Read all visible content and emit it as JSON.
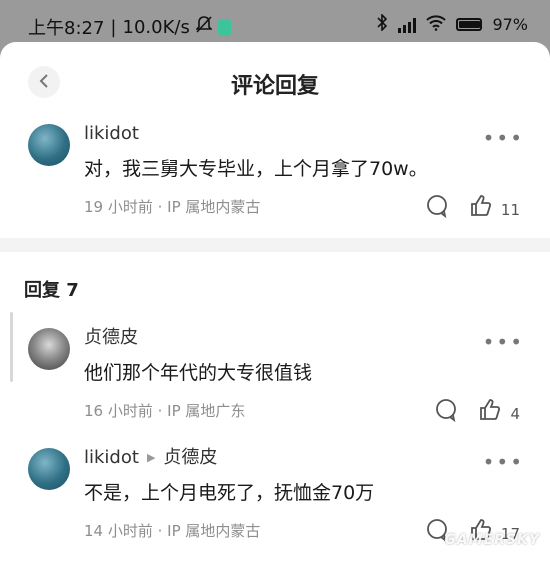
{
  "status_bar": {
    "time": "上午8:27",
    "net_speed": "10.0K/s",
    "battery": "97%",
    "icons": [
      "bell-off-icon",
      "app-notification-icon",
      "bluetooth-icon",
      "hd-signal-icon",
      "wifi-icon",
      "battery-icon"
    ]
  },
  "header": {
    "title": "评论回复",
    "back_icon": "chevron-left-icon"
  },
  "main_comment": {
    "author": "likidot",
    "text": "对，我三舅大专毕业，上个月拿了70w。",
    "meta": "19 小时前 · IP 属地内蒙古",
    "like_count": "11"
  },
  "replies_header": {
    "label": "回复 7"
  },
  "replies": [
    {
      "author": "贞德皮",
      "reply_to": "",
      "text": "他们那个年代的大专很值钱",
      "meta": "16 小时前 · IP 属地广东",
      "like_count": "4"
    },
    {
      "author": "likidot",
      "reply_to": "贞德皮",
      "text": "不是，上个月电死了，抚恤金70万",
      "meta": "14 小时前 · IP 属地内蒙古",
      "like_count": "17"
    }
  ],
  "watermark": "GAMERSKY"
}
